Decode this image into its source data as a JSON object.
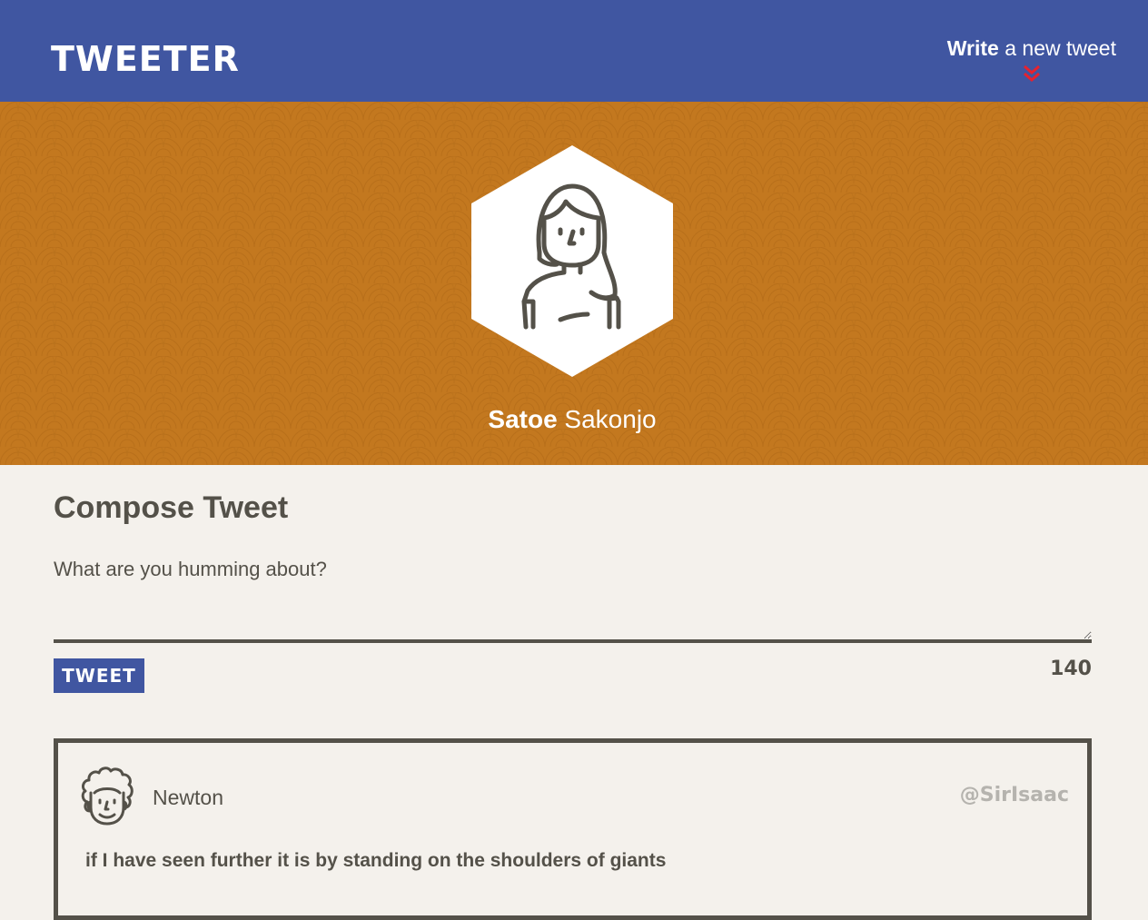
{
  "nav": {
    "brand": "TWEETER",
    "compose_strong": "Write",
    "compose_rest": " a new tweet"
  },
  "profile": {
    "first_name": "Satoe",
    "last_name": " Sakonjo"
  },
  "compose": {
    "title": "Compose Tweet",
    "placeholder": "What are you humming about?",
    "button_label": "TWEET",
    "counter": "140"
  },
  "tweets": [
    {
      "name": "Newton",
      "handle": "@SirIsaac",
      "text": "if I have seen further it is by standing on the shoulders of giants"
    }
  ],
  "colors": {
    "nav": "#4056a1",
    "header": "#c3781f",
    "background": "#f4f1ec",
    "text": "#545149",
    "accent": "#e8212e",
    "handle": "#b5b3ae"
  }
}
